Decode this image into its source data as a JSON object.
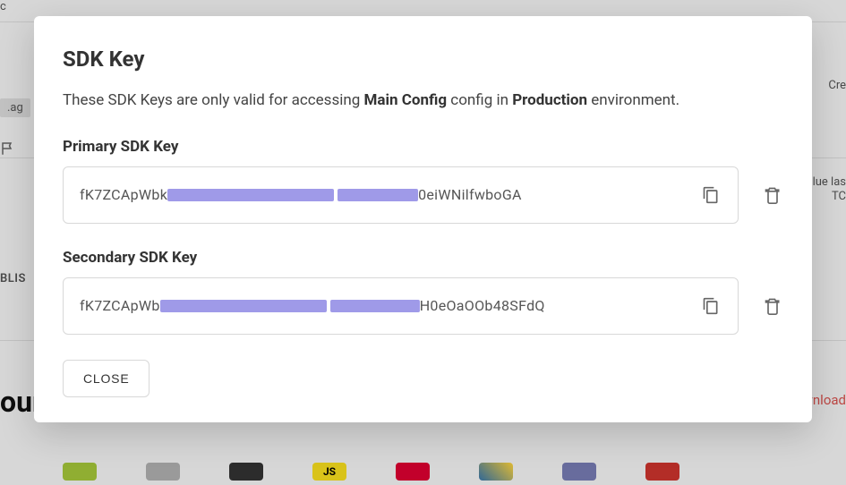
{
  "background": {
    "fragment_c": "c",
    "tag": ".ag",
    "create_fragment": "Cre",
    "alue_fragment": "alue las",
    "tc_fragment": "TC",
    "blis_fragment": "BLIS",
    "our_fragment": "our",
    "download_fragment": "vnload"
  },
  "modal": {
    "title": "SDK Key",
    "description_prefix": "These SDK Keys are only valid for accessing ",
    "config_name": "Main Config",
    "description_mid": " config in ",
    "environment_name": "Production",
    "description_suffix": " environment.",
    "primary_label": "Primary SDK Key",
    "primary_key_prefix": "fK7ZCApWbk",
    "primary_key_suffix": "0eiWNilfwboGA",
    "secondary_label": "Secondary SDK Key",
    "secondary_key_prefix": "fK7ZCApWb",
    "secondary_key_suffix": "H0eOaOOb48SFdQ",
    "close_label": "CLOSE"
  }
}
